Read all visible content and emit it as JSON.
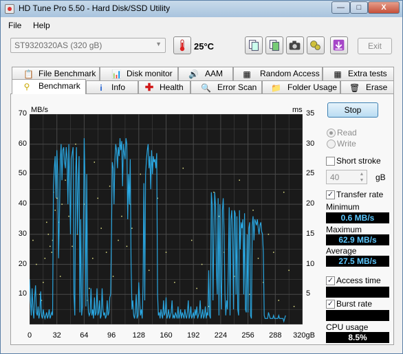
{
  "window": {
    "title": "HD Tune Pro 5.50 - Hard Disk/SSD Utility",
    "buttons": {
      "minimize": "—",
      "maximize": "□",
      "close": "X"
    }
  },
  "menu": {
    "file": "File",
    "help": "Help"
  },
  "toolbar": {
    "drive": "ST9320320AS (320 gB)",
    "temperature": "25°C",
    "exit_label": "Exit"
  },
  "tabs_top": [
    {
      "label": "File Benchmark",
      "icon": "file-benchmark-icon"
    },
    {
      "label": "Disk monitor",
      "icon": "disk-monitor-icon"
    },
    {
      "label": "AAM",
      "icon": "speaker-icon"
    },
    {
      "label": "Random Access",
      "icon": "random-access-icon"
    },
    {
      "label": "Extra tests",
      "icon": "extra-tests-icon"
    }
  ],
  "tabs_bottom": [
    {
      "label": "Benchmark",
      "icon": "benchmark-icon",
      "active": true
    },
    {
      "label": "Info",
      "icon": "info-icon"
    },
    {
      "label": "Health",
      "icon": "health-icon"
    },
    {
      "label": "Error Scan",
      "icon": "error-scan-icon"
    },
    {
      "label": "Folder Usage",
      "icon": "folder-icon"
    },
    {
      "label": "Erase",
      "icon": "erase-icon"
    }
  ],
  "controls": {
    "stop_label": "Stop",
    "read_label": "Read",
    "write_label": "Write",
    "short_stroke_label": "Short stroke",
    "short_stroke_value": "40",
    "short_stroke_unit": "gB",
    "transfer_rate_label": "Transfer rate",
    "access_time_label": "Access time",
    "burst_rate_label": "Burst rate",
    "cpu_usage_label": "CPU usage"
  },
  "stats": {
    "minimum_label": "Minimum",
    "minimum_value": "0.6 MB/s",
    "maximum_label": "Maximum",
    "maximum_value": "62.9 MB/s",
    "average_label": "Average",
    "average_value": "27.5 MB/s",
    "cpu_usage_value": "8.5%"
  },
  "colors": {
    "transfer_line": "#2aa6e0",
    "access_dots": "#e6e68a",
    "chart_bg": "#1a1a1a",
    "grid": "#4a4a4a"
  },
  "chart_data": {
    "type": "line",
    "ylabel_left": "MB/s",
    "ylabel_right": "ms",
    "xlabel_unit": "gB",
    "xlim": [
      0,
      320
    ],
    "ylim": [
      0,
      70
    ],
    "y2lim": [
      0,
      35
    ],
    "left_ticks": [
      "70",
      "60",
      "50",
      "40",
      "30",
      "20",
      "10"
    ],
    "right_ticks": [
      "35",
      "30",
      "25",
      "20",
      "15",
      "10",
      "5"
    ],
    "x_ticks": [
      "0",
      "32",
      "64",
      "96",
      "128",
      "160",
      "192",
      "224",
      "256",
      "288",
      "320gB"
    ],
    "grid": true,
    "series": [
      {
        "values": {
          "x": [
            0,
            1,
            2,
            3,
            4,
            5,
            6,
            7,
            8,
            9,
            10,
            11,
            12,
            13,
            14,
            15,
            16,
            17,
            18,
            19,
            20,
            21,
            22,
            23,
            24,
            25,
            26,
            27,
            28,
            29,
            30,
            31,
            32,
            33,
            34,
            35,
            36,
            37,
            38,
            39,
            40,
            41,
            42,
            43,
            44,
            45,
            46,
            47,
            48,
            49,
            50,
            51,
            52,
            53,
            54,
            55,
            56,
            57,
            58,
            59,
            60,
            61,
            62,
            63,
            64,
            65,
            66,
            67,
            68,
            69,
            70,
            71,
            72,
            73,
            74,
            75,
            76,
            77,
            78,
            79,
            80,
            81,
            82,
            83,
            84,
            85,
            86,
            87,
            88,
            89,
            90,
            91,
            92,
            93,
            94,
            95,
            96,
            97,
            98,
            99,
            100,
            101,
            102,
            103,
            104,
            105,
            106,
            107,
            108,
            109,
            110,
            111,
            112,
            113,
            114,
            115,
            116,
            117,
            118,
            119,
            120,
            121,
            122,
            123,
            124,
            125,
            126,
            127,
            128,
            129,
            130,
            131,
            132,
            133,
            134,
            135,
            136,
            137,
            138,
            139,
            140,
            141,
            142,
            143,
            144,
            145,
            146,
            147,
            148,
            149,
            150,
            151,
            152,
            153,
            154,
            155,
            156,
            157,
            158,
            159,
            160,
            161,
            162,
            163,
            164,
            165,
            166,
            167,
            168,
            169,
            170,
            171,
            172,
            173,
            174,
            175,
            176,
            177,
            178,
            179,
            180,
            181,
            182,
            183,
            184,
            185,
            186,
            187,
            188,
            189,
            190,
            191,
            192,
            193,
            194,
            195,
            196,
            197,
            198,
            199,
            200,
            201,
            202,
            203,
            204,
            205,
            206,
            207,
            208,
            209,
            210,
            211,
            212,
            213,
            214,
            215,
            216,
            217,
            218,
            219,
            220,
            221,
            222,
            223,
            224,
            225,
            226,
            227,
            228,
            229,
            230,
            231,
            232,
            233,
            234,
            235,
            236,
            237,
            238,
            239,
            240,
            241,
            242,
            243,
            244,
            245,
            246,
            247,
            248,
            249,
            250,
            251,
            252,
            253,
            254,
            255,
            256,
            257,
            258,
            259,
            260,
            261,
            262,
            263,
            264,
            265,
            266,
            267,
            268,
            269,
            270,
            271,
            272,
            273,
            274,
            275,
            276,
            277,
            278,
            279,
            280,
            281,
            282,
            283,
            284,
            285,
            286,
            287,
            288,
            289,
            290,
            291,
            292,
            293,
            294,
            295,
            296,
            297,
            298,
            299,
            300,
            301,
            302,
            303,
            304,
            305,
            306,
            307,
            308,
            309,
            310,
            311,
            312,
            313,
            314,
            315,
            316,
            317,
            318,
            319,
            320
          ],
          "y": [
            15,
            8,
            3,
            12,
            5,
            2,
            9,
            13,
            4,
            3,
            6,
            2,
            4,
            11,
            3,
            2,
            5,
            3,
            2,
            3,
            4,
            2,
            3,
            5,
            2,
            3,
            4,
            3,
            46,
            52,
            56,
            42,
            58,
            50,
            22,
            36,
            55,
            60,
            48,
            58,
            59,
            54,
            52,
            59,
            55,
            40,
            60,
            47,
            30,
            55,
            57,
            59,
            10,
            3,
            50,
            59,
            30,
            47,
            56,
            4,
            35,
            3,
            6,
            30,
            62,
            48,
            6,
            50,
            10,
            4,
            3,
            4,
            12,
            3,
            5,
            2,
            9,
            3,
            4,
            12,
            3,
            4,
            8,
            2,
            3,
            12,
            5,
            3,
            4,
            2,
            3,
            8,
            3,
            4,
            9,
            10,
            30,
            54,
            52,
            40,
            55,
            60,
            58,
            52,
            59,
            56,
            62,
            58,
            61,
            46,
            60,
            57,
            55,
            62,
            60,
            35,
            50,
            40,
            55,
            20,
            5,
            8,
            3,
            2,
            4,
            10,
            2,
            3,
            14,
            8,
            3,
            5,
            2,
            13,
            47,
            8,
            50,
            55,
            58,
            60,
            52,
            56,
            45,
            58,
            50,
            56,
            54,
            55,
            52,
            57,
            10,
            3,
            4,
            2,
            5,
            3,
            2,
            8,
            3,
            4,
            9,
            2,
            3,
            5,
            2,
            3,
            4,
            8,
            2,
            3,
            2,
            4,
            3,
            2,
            6,
            2,
            3,
            5,
            2,
            4,
            3,
            2,
            5,
            3,
            2,
            4,
            8,
            2,
            3,
            6,
            2,
            3,
            4,
            2,
            5,
            3,
            6,
            2,
            3,
            4,
            8,
            2,
            3,
            5,
            2,
            3,
            6,
            2,
            4,
            3,
            18,
            3,
            2,
            44,
            40,
            8,
            30,
            44,
            39,
            18,
            10,
            42,
            3,
            40,
            15,
            5,
            38,
            42,
            30,
            10,
            3,
            8,
            5,
            20,
            39,
            3,
            35,
            38,
            30,
            5,
            38,
            37,
            10,
            36,
            5,
            3,
            38,
            25,
            34,
            32,
            35,
            10,
            37,
            5,
            4,
            30,
            4,
            32,
            34,
            3,
            2,
            33,
            36,
            28,
            35,
            34,
            33,
            35,
            32,
            30,
            33,
            34,
            31,
            30,
            24,
            3,
            2,
            2,
            2,
            2,
            4,
            3,
            2,
            2,
            2,
            2,
            3,
            2,
            2,
            2,
            2,
            2,
            3,
            2,
            2,
            2,
            2,
            2,
            1,
            2,
            3
          ]
        }
      }
    ],
    "access_time_points": [
      [
        4,
        14
      ],
      [
        8,
        10
      ],
      [
        12,
        5
      ],
      [
        14,
        4
      ],
      [
        16,
        7
      ],
      [
        18,
        11
      ],
      [
        20,
        17
      ],
      [
        22,
        15
      ],
      [
        24,
        13
      ],
      [
        26,
        12
      ],
      [
        27,
        14
      ],
      [
        28,
        22
      ],
      [
        30,
        19
      ],
      [
        32,
        21
      ],
      [
        34,
        17
      ],
      [
        36,
        8
      ],
      [
        38,
        20
      ],
      [
        42,
        24
      ],
      [
        46,
        18
      ],
      [
        50,
        13
      ],
      [
        54,
        30
      ],
      [
        56,
        15
      ],
      [
        64,
        20
      ],
      [
        68,
        4
      ],
      [
        70,
        6
      ],
      [
        74,
        11
      ],
      [
        76,
        27
      ],
      [
        80,
        21
      ],
      [
        84,
        16
      ],
      [
        90,
        12
      ],
      [
        94,
        23
      ],
      [
        98,
        8
      ],
      [
        104,
        14
      ],
      [
        108,
        18
      ],
      [
        114,
        13
      ],
      [
        118,
        20
      ],
      [
        120,
        16
      ],
      [
        130,
        25
      ],
      [
        140,
        9
      ],
      [
        150,
        21
      ],
      [
        160,
        12
      ],
      [
        170,
        7
      ],
      [
        180,
        26
      ],
      [
        190,
        14
      ],
      [
        196,
        6
      ],
      [
        202,
        10
      ],
      [
        210,
        3
      ],
      [
        216,
        22
      ],
      [
        222,
        18
      ],
      [
        228,
        12
      ],
      [
        234,
        16
      ],
      [
        240,
        8
      ],
      [
        246,
        24
      ],
      [
        252,
        14
      ],
      [
        258,
        5
      ],
      [
        262,
        19
      ],
      [
        268,
        11
      ],
      [
        274,
        7
      ],
      [
        280,
        15
      ],
      [
        286,
        12
      ],
      [
        292,
        4
      ],
      [
        298,
        22
      ],
      [
        304,
        9
      ],
      [
        310,
        3
      ]
    ]
  }
}
